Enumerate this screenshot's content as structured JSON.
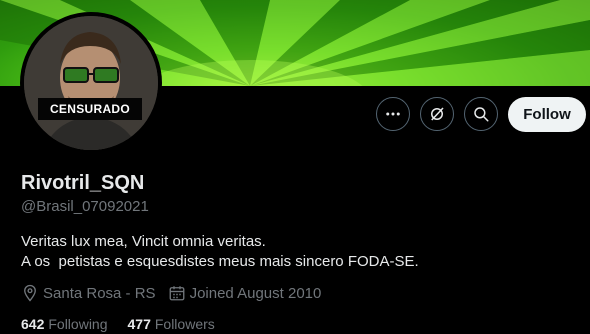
{
  "profile": {
    "avatar_badge": "CENSURADO",
    "name": "Rivotril_SQN",
    "handle": "@Brasil_07092021",
    "bio_line1": "Veritas lux mea, Vincit omnia veritas.",
    "bio_line2": "A os  petistas e esquesdistes meus mais sincero FODA-SE.",
    "location": "Santa Rosa - RS",
    "joined": "Joined August 2010",
    "following_count": "642",
    "following_label": "Following",
    "followers_count": "477",
    "followers_label": "Followers"
  },
  "actions": {
    "more_icon": "more-horizontal-icon",
    "grok_icon": "grok-icon",
    "search_icon": "search-icon",
    "follow_label": "Follow"
  },
  "meta_icons": {
    "location_icon": "location-pin-icon",
    "calendar_icon": "calendar-icon"
  },
  "colors": {
    "background": "#000000",
    "banner": "#4fc21a",
    "text_primary": "#e7e9ea",
    "text_secondary": "#71767b",
    "follow_button_bg": "#eff3f4"
  }
}
